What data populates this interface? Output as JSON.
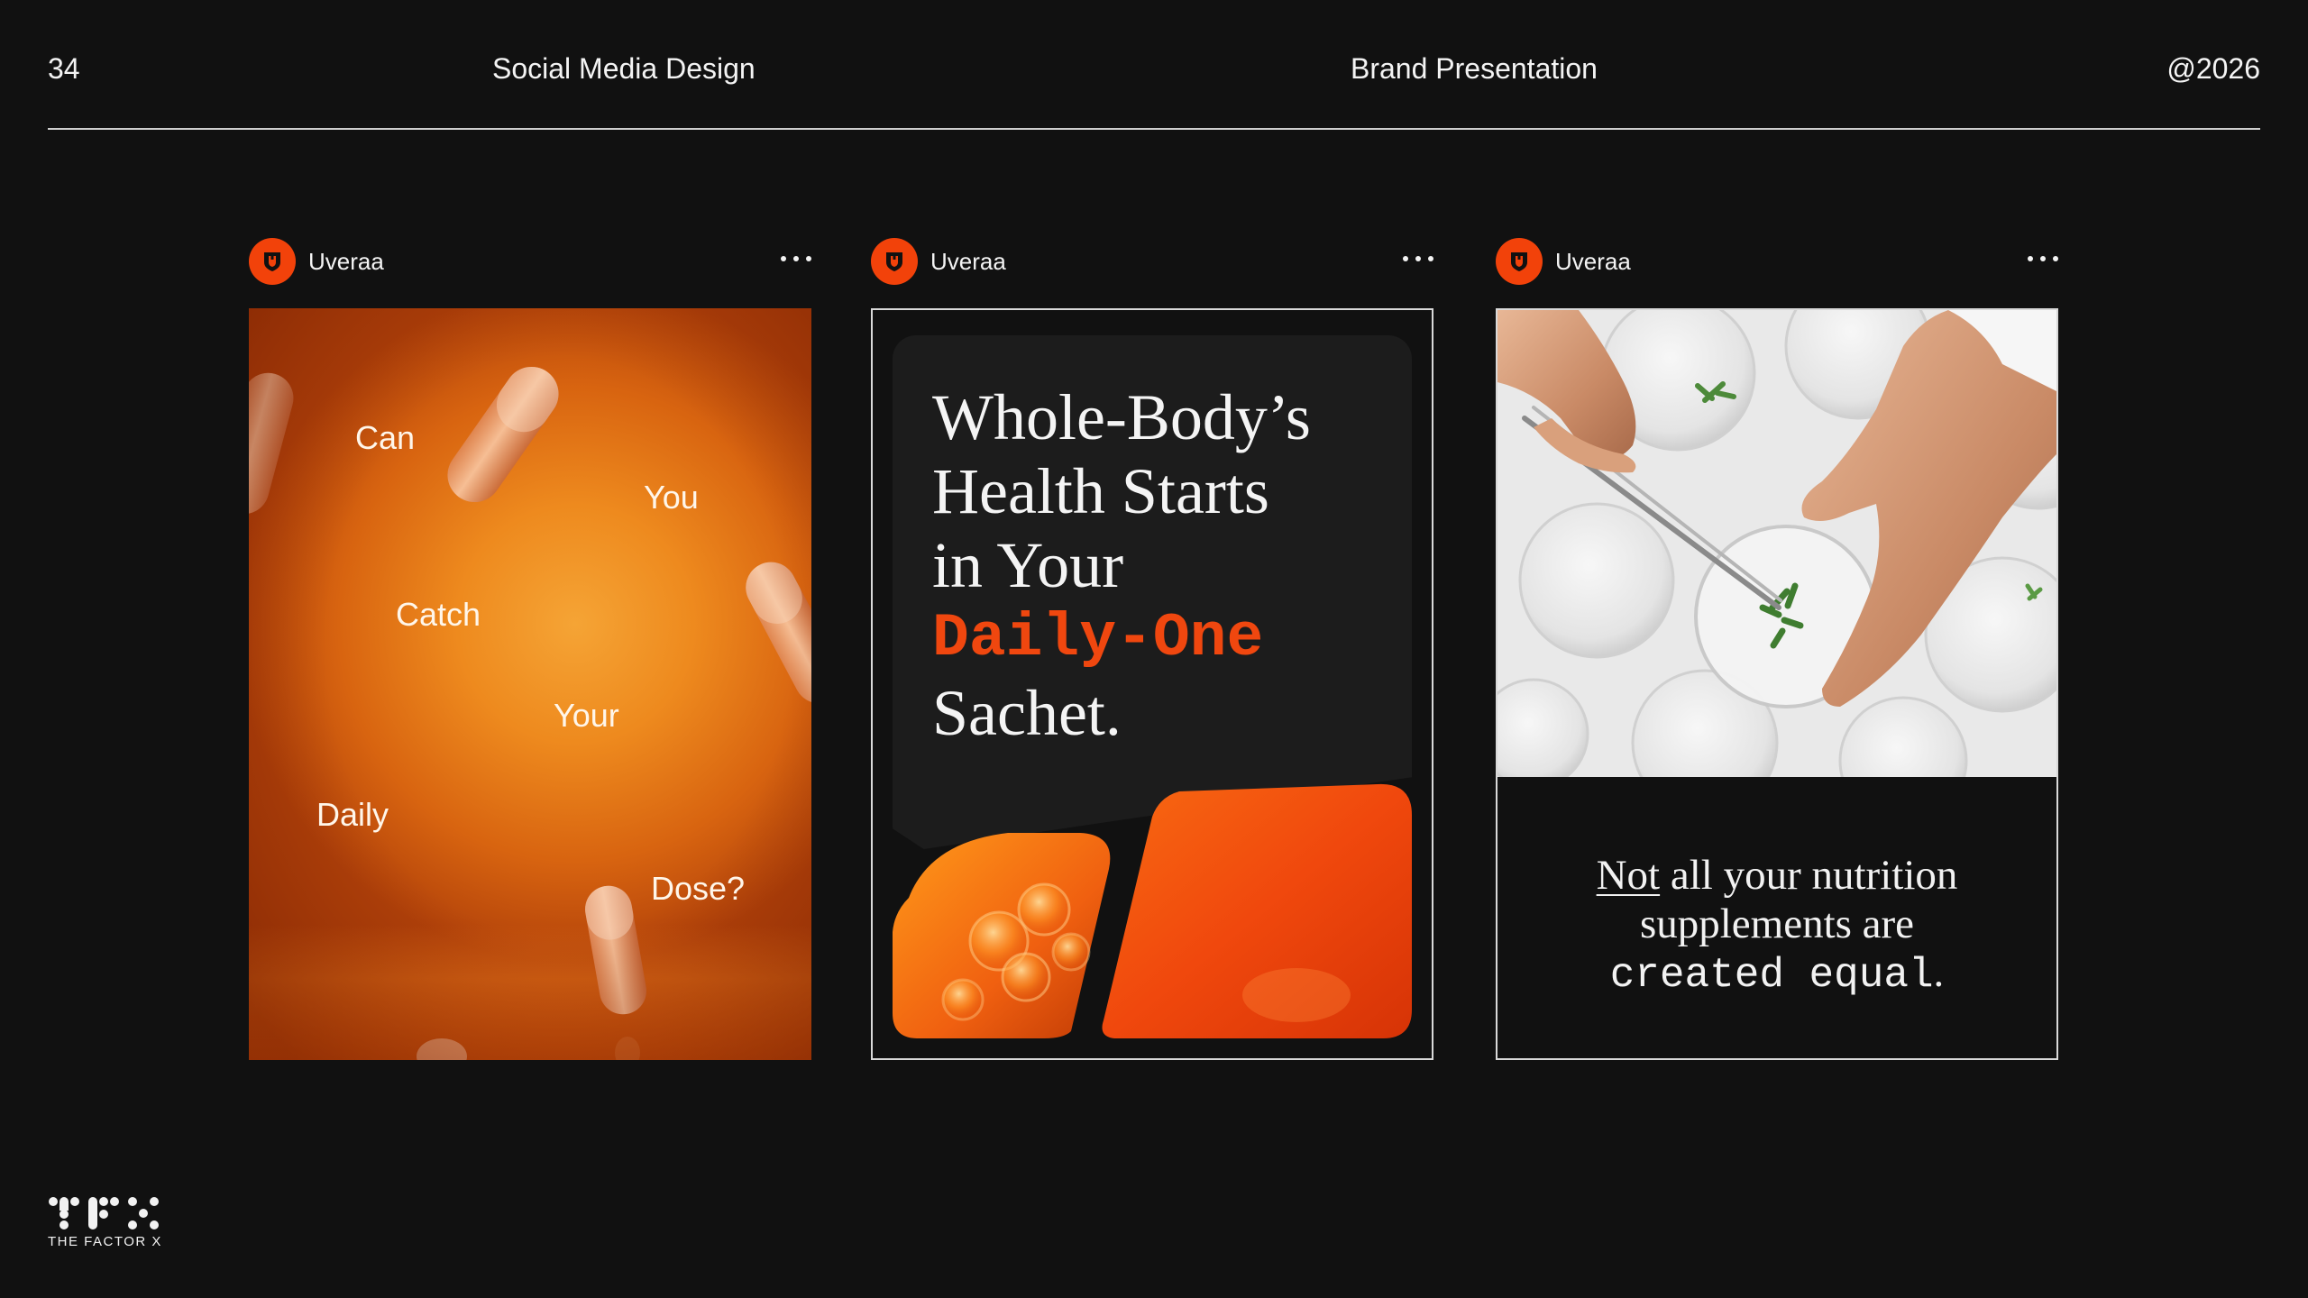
{
  "header": {
    "page_number": "34",
    "section": "Social Media Design",
    "presentation": "Brand Presentation",
    "year": "@2026"
  },
  "posts": [
    {
      "account": "Uveraa",
      "words": [
        "Can",
        "You",
        "Catch",
        "Your",
        "Daily",
        "Dose?"
      ]
    },
    {
      "account": "Uveraa",
      "headline": {
        "line1": "Whole-Body’s",
        "line2": "Health Starts",
        "line3": "in Your",
        "accent": "Daily-One",
        "line5": "Sachet."
      }
    },
    {
      "account": "Uveraa",
      "caption": {
        "underlined": "Not",
        "rest1": " all your nutrition",
        "line2": "supplements are",
        "mono": "created equal",
        "end": "."
      }
    }
  ],
  "brand": {
    "logo_text": "THE FACTOR X",
    "accent_color": "#f0470f",
    "background_color": "#111111"
  },
  "icons": {
    "avatar": "shield-logo-icon",
    "more": "more-horizontal-icon"
  }
}
